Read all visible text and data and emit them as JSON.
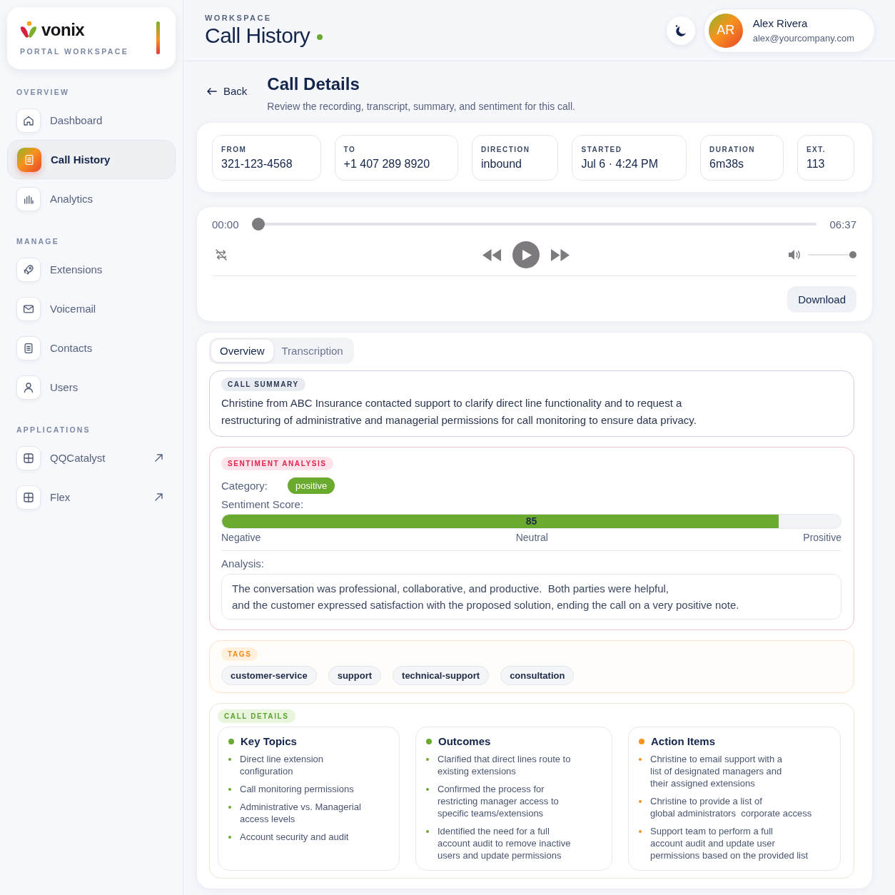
{
  "brand": {
    "name": "vonix",
    "subtitle": "PORTAL WORKSPACE"
  },
  "sidebar": {
    "sections": [
      {
        "heading": "OVERVIEW",
        "items": [
          {
            "label": "Dashboard",
            "selected": false,
            "external": false
          },
          {
            "label": "Call History",
            "selected": true,
            "external": false
          },
          {
            "label": "Analytics",
            "selected": false,
            "external": false
          }
        ]
      },
      {
        "heading": "MANAGE",
        "items": [
          {
            "label": "Extensions",
            "selected": false,
            "external": false
          },
          {
            "label": "Voicemail",
            "selected": false,
            "external": false
          },
          {
            "label": "Contacts",
            "selected": false,
            "external": false
          },
          {
            "label": "Users",
            "selected": false,
            "external": false
          }
        ]
      },
      {
        "heading": "APPLICATIONS",
        "items": [
          {
            "label": "QQCatalyst",
            "selected": false,
            "external": true
          },
          {
            "label": "Flex",
            "selected": false,
            "external": true
          }
        ]
      }
    ]
  },
  "header": {
    "eyebrow": "WORKSPACE",
    "title": "Call History",
    "user": {
      "initials": "AR",
      "name": "Alex Rivera",
      "email": "alex@yourcompany.com"
    }
  },
  "page": {
    "back": "Back",
    "title": "Call Details",
    "subtitle": "Review the recording, transcript, summary, and sentiment for this call."
  },
  "call_info": [
    {
      "label": "FROM",
      "value": "321-123-4568"
    },
    {
      "label": "TO",
      "value": "+1 407 289 8920"
    },
    {
      "label": "DIRECTION",
      "value": "inbound"
    },
    {
      "label": "STARTED",
      "value": "Jul 6 · 4:24 PM"
    },
    {
      "label": "DURATION",
      "value": "6m38s"
    },
    {
      "label": "EXT.",
      "value": "113"
    }
  ],
  "player": {
    "current_time": "00:00",
    "total_time": "06:37",
    "progress": {
      "level": 0
    },
    "volume": {
      "level": 1
    },
    "download": "Download"
  },
  "tabs": [
    {
      "label": "Overview",
      "selected": true
    },
    {
      "label": "Transcription",
      "selected": false
    }
  ],
  "summary": {
    "badge": "CALL SUMMARY",
    "text": "Christine from ABC Insurance contacted support to clarify direct line functionality and to request a\nrestructuring of administrative and managerial permissions for call monitoring to ensure data privacy."
  },
  "sentiment": {
    "badge": "SENTIMENT ANALYSIS",
    "category_label": "Category:",
    "category": "positive",
    "score_label": "Sentiment Score:",
    "score": {
      "value": "85",
      "level": 0.9
    },
    "scale": [
      "Negative",
      "Neutral",
      "Prositive"
    ],
    "analysis_label": "Analysis:",
    "analysis": "The conversation was professional, collaborative, and productive.  Both parties were helpful,\nand the customer expressed satisfaction with the proposed solution, ending the call on a very positive note."
  },
  "tags": {
    "badge": "TAGS",
    "items": [
      "customer-service",
      "support",
      "technical-support",
      "consultation"
    ]
  },
  "details": {
    "badge": "CALL DETAILS",
    "columns": [
      {
        "title": "Key Topics",
        "color": "#6aaa2e",
        "items": [
          "Direct line extension\nconfiguration",
          "Call monitoring permissions",
          "Administrative vs. Managerial\naccess levels",
          "Account security and audit"
        ]
      },
      {
        "title": "Outcomes",
        "color": "#6aaa2e",
        "items": [
          "Clarified that direct lines route to\nexisting extensions",
          "Confirmed the process for\nrestricting manager access to\nspecific teams/extensions",
          "Identified the need for a full\naccount audit to remove inactive\nusers and update permissions"
        ]
      },
      {
        "title": "Action Items",
        "color": "#f7931e",
        "items": [
          "Christine to email support with a\nlist of designated managers and\ntheir assigned extensions",
          "Christine to provide a list of\nglobal administrators  corporate access",
          "Support team to perform a full\naccount audit and update user\npermissions based on the provided list"
        ]
      }
    ]
  }
}
